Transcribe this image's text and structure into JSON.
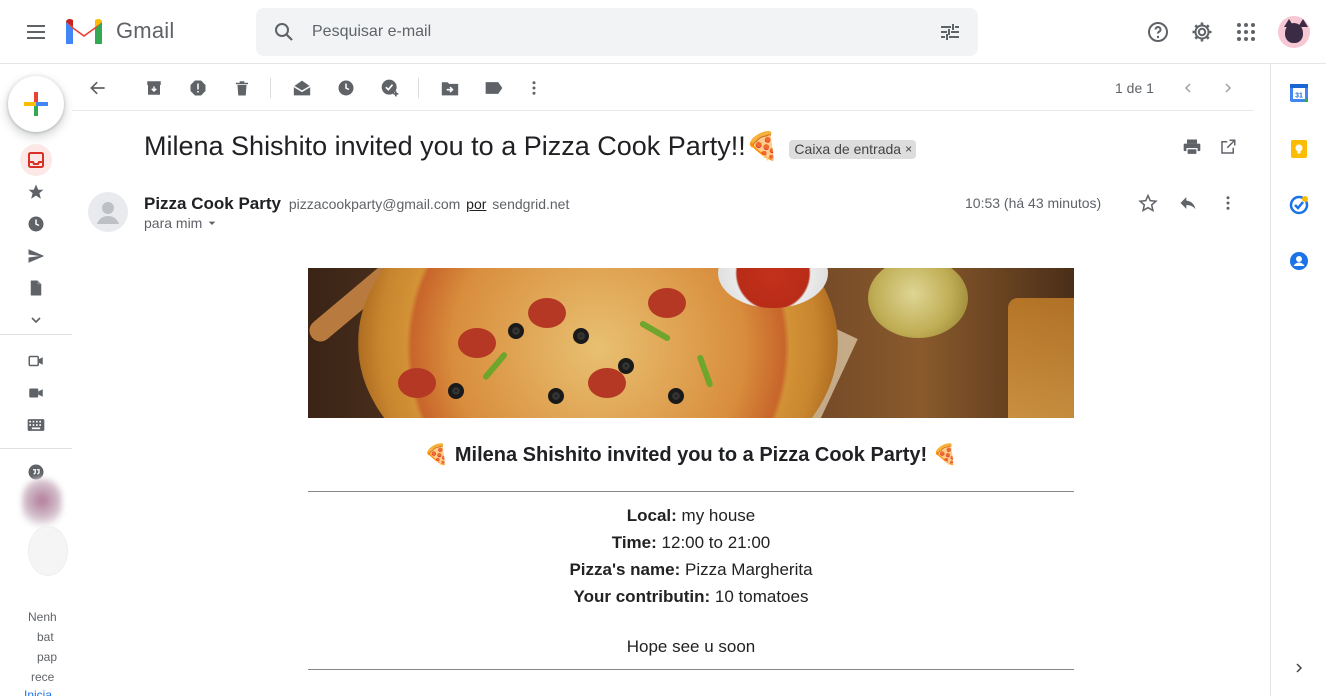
{
  "app": {
    "name": "Gmail",
    "search_placeholder": "Pesquisar e-mail"
  },
  "toolbar": {
    "pager": "1 de 1"
  },
  "message": {
    "subject": "Milena Shishito invited you to a Pizza Cook Party!!🍕",
    "label": "Caixa de entrada",
    "label_remove": "×",
    "sender_name": "Pizza Cook Party",
    "sender_email": "pizzacookparty@gmail.com",
    "via_label": "por",
    "via_domain": "sendgrid.net",
    "recipient": "para mim",
    "time": "10:53 (há 43 minutos)"
  },
  "email_body": {
    "title": "🍕 Milena Shishito invited you to a Pizza Cook Party! 🍕",
    "details": [
      {
        "label": "Local:",
        "value": "my house"
      },
      {
        "label": "Time:",
        "value": "12:00 to 21:00"
      },
      {
        "label": "Pizza's name:",
        "value": "Pizza Margherita"
      },
      {
        "label": "Your contributin:",
        "value": "10 tomatoes"
      }
    ],
    "closing": "Hope see u soon"
  },
  "left_rail": {
    "partial_text": [
      "Nenh",
      "bat",
      "pap",
      "rece",
      "Inicia"
    ]
  },
  "colors": {
    "accent_blue": "#1a73e8",
    "active_red": "#d93025",
    "active_bg": "#fce8e6"
  }
}
